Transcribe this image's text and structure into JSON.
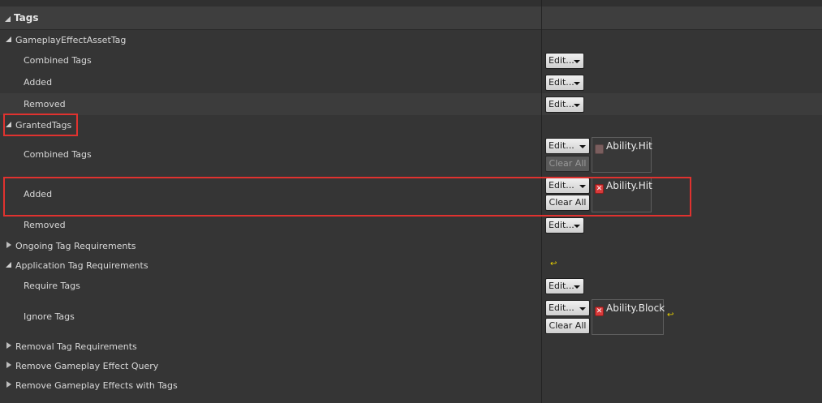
{
  "category": {
    "label": "Tags"
  },
  "rows": {
    "gameplay_effect_asset_tag": {
      "label": "GameplayEffectAssetTag"
    },
    "geat_combined": {
      "label": "Combined Tags",
      "edit": "Edit..."
    },
    "geat_added": {
      "label": "Added",
      "edit": "Edit..."
    },
    "geat_removed": {
      "label": "Removed",
      "edit": "Edit..."
    },
    "granted_tags": {
      "label": "GrantedTags"
    },
    "gt_combined": {
      "label": "Combined Tags",
      "edit": "Edit...",
      "clear": "Clear All",
      "tag": "Ability.Hit"
    },
    "gt_added": {
      "label": "Added",
      "edit": "Edit...",
      "clear": "Clear All",
      "tag": "Ability.Hit"
    },
    "gt_removed": {
      "label": "Removed",
      "edit": "Edit..."
    },
    "ongoing": {
      "label": "Ongoing Tag Requirements"
    },
    "application": {
      "label": "Application Tag Requirements"
    },
    "require": {
      "label": "Require Tags",
      "edit": "Edit..."
    },
    "ignore": {
      "label": "Ignore Tags",
      "edit": "Edit...",
      "clear": "Clear All",
      "tag": "Ability.Block"
    },
    "removal": {
      "label": "Removal Tag Requirements"
    },
    "remove_query": {
      "label": "Remove Gameplay Effect Query"
    },
    "remove_with_tags": {
      "label": "Remove Gameplay Effects with Tags"
    }
  },
  "icons": {
    "expanded": "triangle-down-icon",
    "collapsed": "triangle-right-icon",
    "remove_tag": "remove-tag-icon",
    "reset_to_default": "reset-arrow-icon"
  },
  "colors": {
    "background": "#353535",
    "highlight_box": "#e0322f",
    "reset_arrow": "#e8d000",
    "remove_tag": "#d83a3a"
  }
}
